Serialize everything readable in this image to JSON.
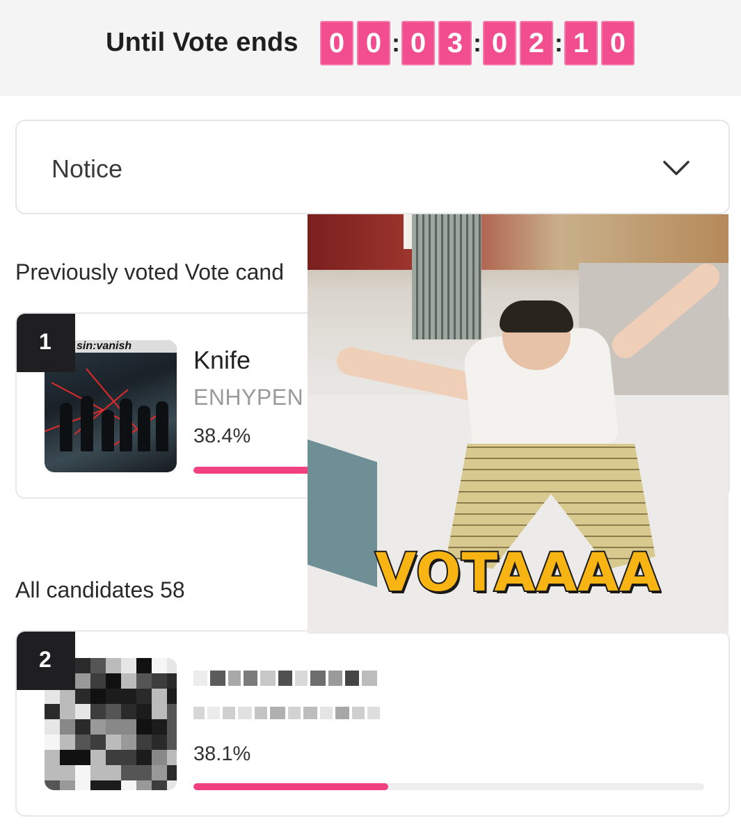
{
  "header": {
    "until_label": "Until Vote ends",
    "countdown_digits": [
      "0",
      "0",
      "0",
      "3",
      "0",
      "2",
      "1",
      "0"
    ],
    "separator": ":"
  },
  "notice": {
    "label": "Notice",
    "icon": "chevron-down-icon"
  },
  "previous_section": {
    "label": "Previously voted Vote cand"
  },
  "all_section": {
    "label": "All candidates 58"
  },
  "candidates": [
    {
      "rank": "1",
      "title": "Knife",
      "artist": "ENHYPEN",
      "percent": "38.4%",
      "progress": 0.384,
      "album_text": "sin:vanish"
    },
    {
      "rank": "2",
      "title": "",
      "artist": "",
      "percent": "38.1%",
      "progress": 0.381
    }
  ],
  "meme": {
    "caption": "VOTAAAA"
  },
  "colors": {
    "accent": "#f24d8f",
    "bar": "#f0407f",
    "caption": "#f7b412"
  }
}
